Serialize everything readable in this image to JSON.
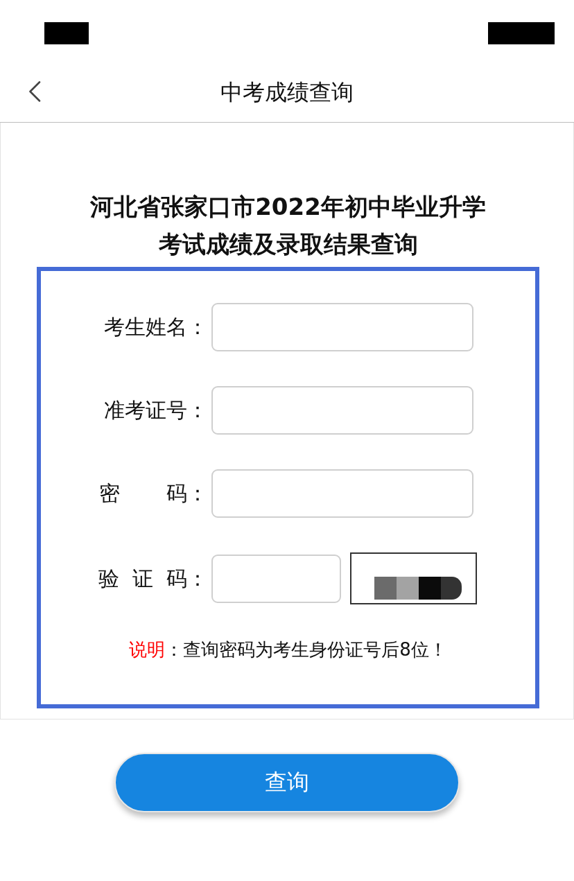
{
  "nav": {
    "title": "中考成绩查询"
  },
  "heading": {
    "lines": [
      "河北省张家口市2022年初中毕业升学",
      "考试成绩及录取结果查询"
    ]
  },
  "form": {
    "fields": [
      {
        "label": "考生姓名：",
        "kind": "text"
      },
      {
        "label": "准考证号：",
        "kind": "text"
      },
      {
        "label": "密       码：",
        "kind": "text"
      },
      {
        "label": "验  证  码：",
        "kind": "captcha"
      }
    ]
  },
  "note": {
    "label": "说明",
    "text": "：查询密码为考生身份证号后8位！"
  },
  "submit_button": {
    "label": "查询"
  }
}
